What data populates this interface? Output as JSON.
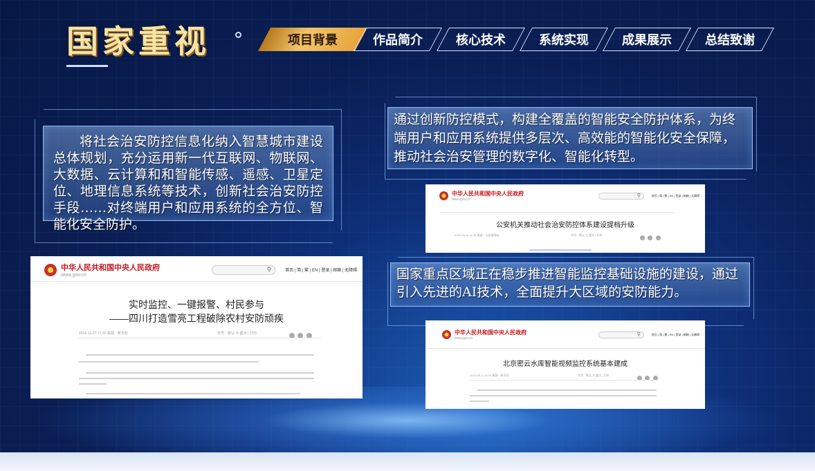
{
  "title": "国家重视",
  "nav": [
    {
      "label": "项目背景",
      "active": true
    },
    {
      "label": "作品简介",
      "active": false
    },
    {
      "label": "核心技术",
      "active": false
    },
    {
      "label": "系统实现",
      "active": false
    },
    {
      "label": "成果展示",
      "active": false
    },
    {
      "label": "总结致谢",
      "active": false
    }
  ],
  "panels": {
    "left": "将社会治安防控信息化纳入智慧城市建设总体规划，充分运用新一代互联网、物联网、大数据、云计算和和智能传感、遥感、卫星定位、地理信息系统等技术，创新社会治安防控手段……对终端用户和应用系统的全方位、智能化安全防护。",
    "top_right": "通过创新防控模式，构建全覆盖的智能安全防护体系，为终端用户和应用系统提供多层次、高效能的智能化安全保障，推动社会治安管理的数字化、智能化转型。",
    "middle_right": "国家重点区域正在稳步推进智能监控基础设施的建设，通过引入先进的AI技术，全面提升大区域的安防能力。"
  },
  "shots": {
    "common": {
      "site_name": "中华人民共和国中央人民政府",
      "site_url": "www.gov.cn",
      "links": "首页 | 简 | 繁 | EN | 登录 | 邮箱 | 无障碍",
      "search_icon": "search-icon"
    },
    "left": {
      "headline_1": "实时监控、一键报警、村民参与",
      "headline_2": "——四川打造雪亮工程破除农村安防顽疾",
      "meta": "2016-12-27 17:30   来源：新华社",
      "tools": "字号：默认 大 超大   |   打印"
    },
    "top_right": {
      "headline": "公安机关推动社会治安防控体系建设提档升级",
      "meta": "2019-05-14 11:18   来源：公安部网站",
      "tools": "字号：默认 大 超大   |   打印"
    },
    "bottom_right": {
      "headline": "北京密云水库智能视频监控系统基本建成",
      "meta": "2019-06-11 20:40   来源：新华社",
      "tools": "字号：默认 大 超大   |   打印"
    }
  },
  "colors": {
    "accent_gold": "#f1c46a",
    "gov_red": "#c8161d",
    "panel_border": "#aacdff"
  }
}
